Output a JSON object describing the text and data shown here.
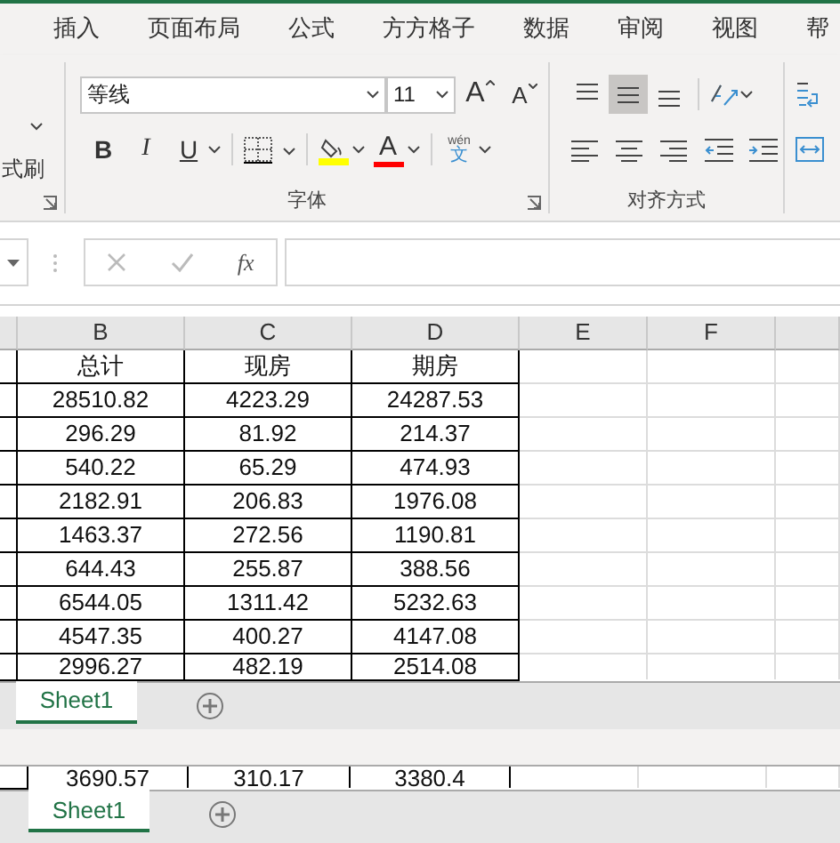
{
  "ribbon_tabs": [
    {
      "label": "插入",
      "selected": false
    },
    {
      "label": "页面布局",
      "selected": false
    },
    {
      "label": "公式",
      "selected": false
    },
    {
      "label": "方方格子",
      "selected": false
    },
    {
      "label": "数据",
      "selected": false
    },
    {
      "label": "审阅",
      "selected": false
    },
    {
      "label": "视图",
      "selected": false
    },
    {
      "label": "帮",
      "selected": false
    }
  ],
  "clipboard": {
    "format_painter_label": "式刷"
  },
  "font_group": {
    "font_name": "等线",
    "font_size": "11",
    "grow_label": "A",
    "shrink_label": "A",
    "bold_label": "B",
    "italic_label": "I",
    "underline_label": "U",
    "font_color_label": "A",
    "phonetic_top": "wén",
    "phonetic_bottom": "文",
    "group_label": "字体"
  },
  "alignment_group": {
    "vertical_align": [
      {
        "kind": "top",
        "selected": false
      },
      {
        "kind": "middle",
        "selected": true
      },
      {
        "kind": "bottom",
        "selected": false
      }
    ],
    "group_label": "对齐方式"
  },
  "formula_bar": {
    "function_label": "fx"
  },
  "sheet": {
    "columns": [
      "B",
      "C",
      "D",
      "E",
      "F"
    ],
    "rows": [
      [
        "总计",
        "现房",
        "期房"
      ],
      [
        "28510.82",
        "4223.29",
        "24287.53"
      ],
      [
        "296.29",
        "81.92",
        "214.37"
      ],
      [
        "540.22",
        "65.29",
        "474.93"
      ],
      [
        "2182.91",
        "206.83",
        "1976.08"
      ],
      [
        "1463.37",
        "272.56",
        "1190.81"
      ],
      [
        "644.43",
        "255.87",
        "388.56"
      ],
      [
        "6544.05",
        "1311.42",
        "5232.63"
      ],
      [
        "4547.35",
        "400.27",
        "4147.08"
      ],
      [
        "2996.27",
        "482.19",
        "2514.08"
      ]
    ]
  },
  "sheet_tabs": [
    {
      "label": "Sheet1",
      "selected": true
    }
  ],
  "lower_view": {
    "row": [
      "3690.57",
      "310.17",
      "3380.4"
    ],
    "sheet_tabs": [
      {
        "label": "Sheet1",
        "selected": true
      }
    ]
  }
}
